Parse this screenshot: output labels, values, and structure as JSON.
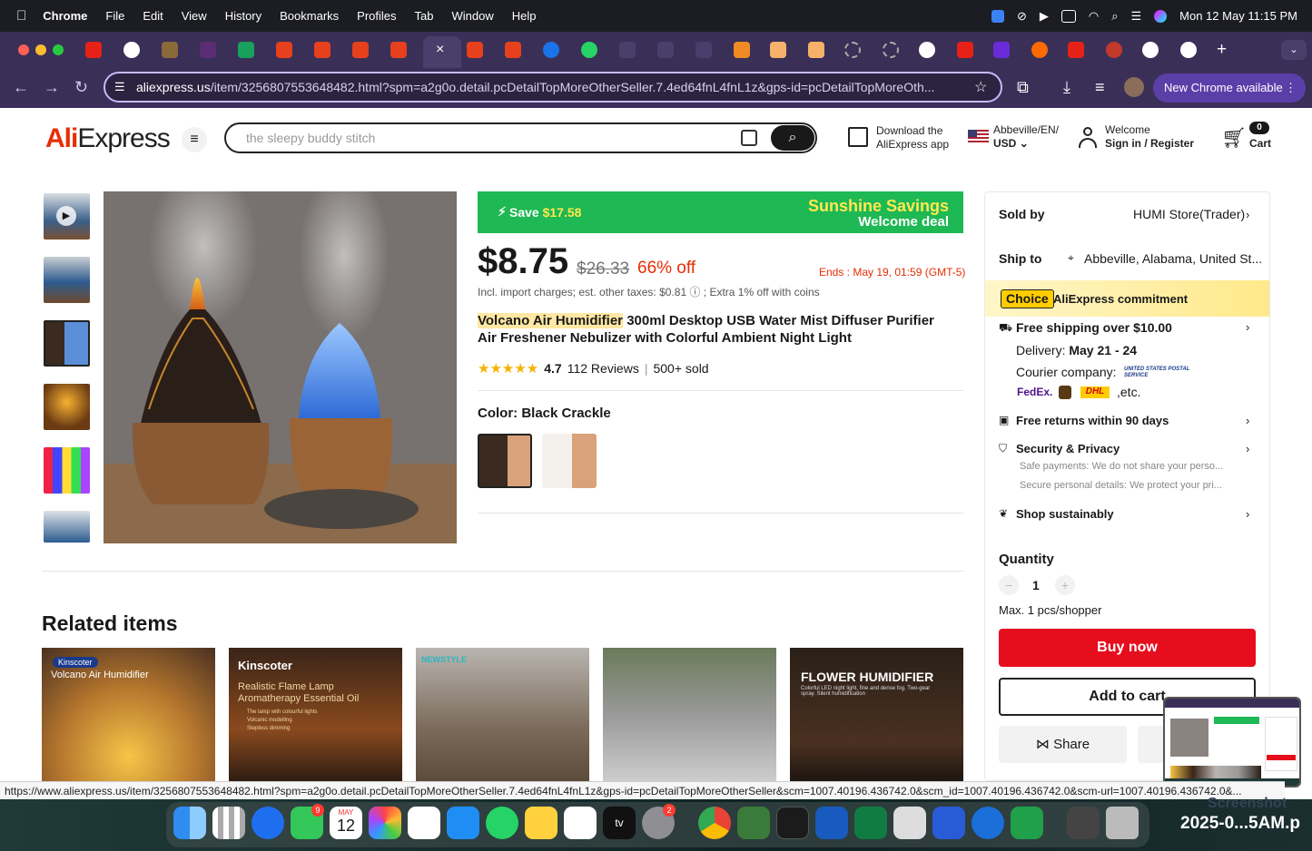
{
  "menubar": {
    "app": "Chrome",
    "items": [
      "File",
      "Edit",
      "View",
      "History",
      "Bookmarks",
      "Profiles",
      "Tab",
      "Window",
      "Help"
    ],
    "datetime": "Mon 12 May  11:15 PM"
  },
  "browser": {
    "url_host": "aliexpress.us",
    "url_rest": "/item/3256807553648482.html?spm=a2g0o.detail.pcDetailTopMoreOtherSeller.7.4ed64fnL4fnL1z&gps-id=pcDetailTopMoreOth...",
    "new_chrome": "New Chrome available",
    "status_url": "https://www.aliexpress.us/item/3256807553648482.html?spm=a2g0o.detail.pcDetailTopMoreOtherSeller.7.4ed64fnL4fnL1z&gps-id=pcDetailTopMoreOtherSeller&scm=1007.40196.436742.0&scm_id=1007.40196.436742.0&scm-url=1007.40196.436742.0&..."
  },
  "header": {
    "logo_a": "Ali",
    "logo_b": "Express",
    "search_placeholder": "the sleepy buddy stitch",
    "download_line1": "Download the",
    "download_line2": "AliExpress app",
    "region_line1": "Abbeville/EN/",
    "region_line2": "USD",
    "welcome": "Welcome",
    "signin": "Sign in / Register",
    "cart_count": "0",
    "cart_label": "Cart"
  },
  "product": {
    "banner_save_prefix": "Save ",
    "banner_save_amount": "$17.58",
    "banner_title": "Sunshine Savings",
    "banner_sub": "Welcome deal",
    "price": "$8.75",
    "old_price": "$26.33",
    "discount": "66% off",
    "ends": "Ends :  May 19, 01:59 (GMT-5)",
    "taxes": "Incl. import charges; est. other taxes: $0.81 ⓘ ; Extra 1% off with coins",
    "title_highlight": "Volcano Air Humidifier",
    "title_rest": " 300ml Desktop USB Water Mist Diffuser Purifier Air Freshener Nebulizer with Colorful Ambient Night Light",
    "rating": "4.7",
    "reviews": "112 Reviews",
    "sold": "500+ sold",
    "color_label": "Color: Black Crackle"
  },
  "related": {
    "heading": "Related items",
    "cards": [
      {
        "brand": "Kinscoter",
        "caption": "Volcano Air Humidifier"
      },
      {
        "brand": "Kinscoter",
        "caption": "Realistic Flame Lamp Aromatherapy Essential Oil",
        "bullets": [
          "The lamp with colourful lights",
          "Volcanic modelling",
          "Stepless dimming"
        ]
      },
      {
        "brand": "NEWSTYLE",
        "caption": ""
      },
      {
        "brand": "",
        "caption": ""
      },
      {
        "brand": "",
        "caption": "FLOWER HUMIDIFIER",
        "sub": "Colorful LED night light, fine and dense fog. Two-gear spray. Silent humidification"
      }
    ]
  },
  "sidebar": {
    "sold_by_label": "Sold by",
    "store": "HUMI Store(Trader)",
    "ship_to_label": "Ship to",
    "ship_to": "Abbeville, Alabama, United St...",
    "choice_badge": "Choice",
    "commitment": "AliExpress commitment",
    "free_shipping": "Free shipping over $10.00",
    "delivery_label": "Delivery: ",
    "delivery_date": "May 21 - 24",
    "courier_label": "Courier company:",
    "courier_usps": "UNITED STATES POSTAL SERVICE",
    "courier_fedex": "FedEx.",
    "courier_etc": ",etc.",
    "returns": "Free returns within 90 days",
    "security": "Security & Privacy",
    "security_1": "Safe payments: We do not share your perso...",
    "security_2": "Secure personal details: We protect your pri...",
    "sustain": "Shop sustainably",
    "quantity_label": "Quantity",
    "quantity": "1",
    "max": "Max. 1 pcs/shopper",
    "buy_now": "Buy now",
    "add_to_cart": "Add to cart",
    "share": "Share"
  },
  "dock": {
    "messages_badge": "9",
    "calendar_month": "MAY",
    "calendar_day": "12",
    "settings_badge": "2",
    "screenshot_label_1": "Screenshot",
    "screenshot_label_2": "2025-0...5AM.p"
  },
  "colors": {
    "brand_red": "#e62e04",
    "buy_red": "#e60d1d",
    "banner_green": "#1eb854",
    "tab_bar": "#3a2f57"
  }
}
